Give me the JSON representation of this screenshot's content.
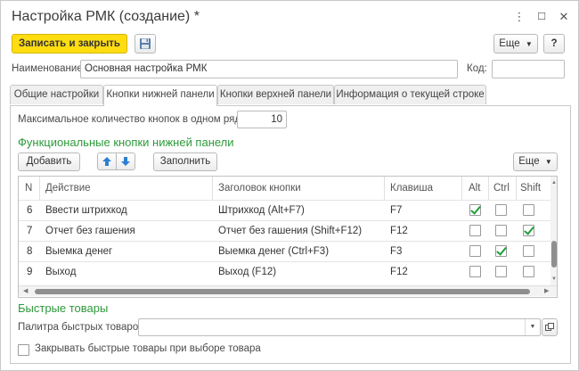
{
  "window": {
    "title": "Настройка РМК (создание) *",
    "controls": [
      "⋮",
      "☐",
      "✕"
    ]
  },
  "toolbar": {
    "save_close_label": "Записать и закрыть",
    "more_label": "Еще",
    "help_label": "?"
  },
  "form": {
    "name_label": "Наименование:",
    "name_value": "Основная настройка РМК",
    "code_label": "Код:",
    "code_value": ""
  },
  "tabs": [
    {
      "label": "Общие настройки",
      "active": false
    },
    {
      "label": "Кнопки нижней панели",
      "active": true
    },
    {
      "label": "Кнопки верхней панели",
      "active": false
    },
    {
      "label": "Информация о текущей строке",
      "active": false
    }
  ],
  "bottom_panel": {
    "max_buttons_label": "Максимальное количество кнопок в одном ряду:",
    "max_buttons_value": "10",
    "section_title": "Функциональные кнопки нижней панели",
    "add_label": "Добавить",
    "fill_label": "Заполнить",
    "more_label": "Еще"
  },
  "table": {
    "columns": [
      "N",
      "Действие",
      "Заголовок кнопки",
      "Клавиша",
      "Alt",
      "Ctrl",
      "Shift"
    ],
    "rows": [
      {
        "n": "6",
        "action": "Ввести штрихкод",
        "caption": "Штрихкод (Alt+F7)",
        "key": "F7",
        "alt": true,
        "ctrl": false,
        "shift": false
      },
      {
        "n": "7",
        "action": "Отчет без гашения",
        "caption": "Отчет без гашения (Shift+F12)",
        "key": "F12",
        "alt": false,
        "ctrl": false,
        "shift": true
      },
      {
        "n": "8",
        "action": "Выемка денег",
        "caption": "Выемка денег (Ctrl+F3)",
        "key": "F3",
        "alt": false,
        "ctrl": true,
        "shift": false
      },
      {
        "n": "9",
        "action": "Выход",
        "caption": "Выход (F12)",
        "key": "F12",
        "alt": false,
        "ctrl": false,
        "shift": false
      }
    ]
  },
  "quick_goods": {
    "section_title": "Быстрые товары",
    "palette_label": "Палитра быстрых товаров:",
    "palette_value": "",
    "close_checkbox_label": "Закрывать быстрые товары при выборе товара",
    "close_checkbox_checked": false
  },
  "colors": {
    "accent_yellow": "#ffdd10",
    "section_green": "#2d9a3b",
    "arrow_blue": "#2a7fd4",
    "check_green": "#1f9e3a"
  }
}
